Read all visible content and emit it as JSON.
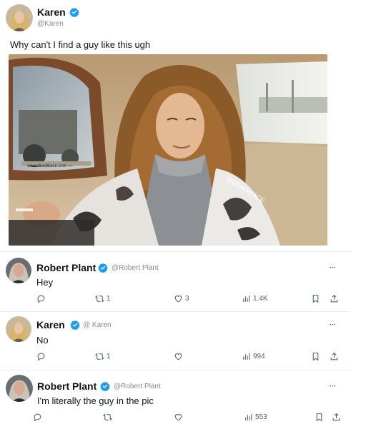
{
  "main_tweet": {
    "name": "Karen",
    "handle": "@Karen",
    "text": "Why can't I find a guy like this ugh",
    "photo_watermark_url": "www.deadikace.com",
    "photo_watermark_tag": "@DEADIKACE"
  },
  "replies": [
    {
      "name": "Robert Plant",
      "handle": "@Robert Plant",
      "text": "Hey",
      "more": "•••",
      "retweets": "1",
      "likes": "3",
      "views": "1.4K"
    },
    {
      "name": "Karen",
      "handle": "@ Karen",
      "text": "No",
      "more": "•••",
      "retweets": "1",
      "likes": "",
      "views": "994"
    },
    {
      "name": "Robert Plant",
      "handle": "@Robert Plant",
      "text": "I'm literally the guy in the pic",
      "more": "•••",
      "retweets": "",
      "likes": "",
      "views": "553"
    }
  ],
  "icons": {
    "verified": "verified-badge-icon",
    "reply": "reply-icon",
    "retweet": "retweet-icon",
    "like": "heart-icon",
    "views": "views-bar-chart-icon",
    "bookmark": "bookmark-icon",
    "share": "share-icon"
  },
  "colors": {
    "verified_blue": "#1d9bf0",
    "text": "#0f1419",
    "secondary": "#536471"
  }
}
